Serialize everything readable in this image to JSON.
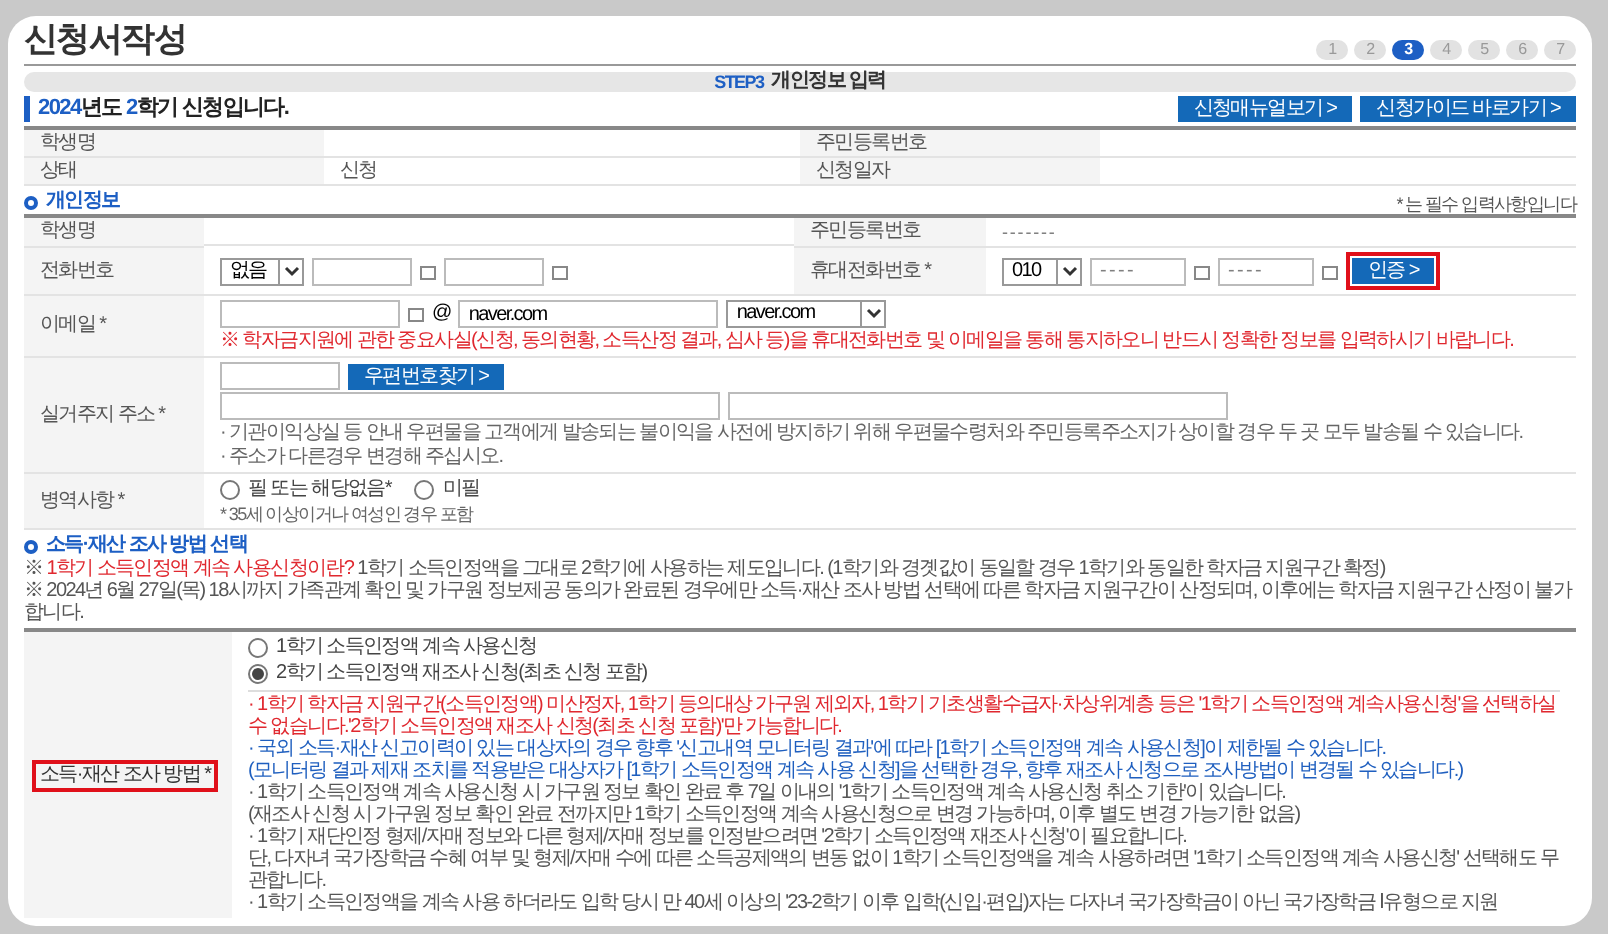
{
  "page_title": "신청서작성",
  "steps": [
    {
      "label": "1",
      "selected": false
    },
    {
      "label": "2",
      "selected": false
    },
    {
      "label": "3",
      "selected": true
    },
    {
      "label": "4",
      "selected": false
    },
    {
      "label": "5",
      "selected": false
    },
    {
      "label": "6",
      "selected": false
    },
    {
      "label": "7",
      "selected": false
    }
  ],
  "step_banner": {
    "step": "STEP3",
    "title": "개인정보 입력"
  },
  "semester_heading": [
    {
      "text": "2024",
      "highlight": true
    },
    {
      "text": "년도 ",
      "highlight": false
    },
    {
      "text": "2",
      "highlight": true
    },
    {
      "text": "학기 신청입니다.",
      "highlight": false
    }
  ],
  "header_buttons": [
    "신청매뉴얼보기 >",
    "신청가이드 바로가기 >"
  ],
  "summary_table": [
    [
      {
        "label": "학생명"
      },
      {
        "label": "주민등록번호"
      }
    ],
    [
      {
        "label": "상태",
        "value": "신청"
      },
      {
        "label": "신청일자"
      }
    ]
  ],
  "personal_info": {
    "title": "개인정보",
    "required_note": "* 는 필수 입력사항입니다",
    "name_row": {
      "label": "학생명",
      "id_label": "주민등록번호",
      "id_value": "- - - - - -   -"
    },
    "phone_row": {
      "label": "전화번호",
      "select": "없음",
      "mobile_label": "휴대전화번호 *",
      "mobile_select": "010",
      "mobile_placeholder": "- - - -",
      "verify_button": {
        "label": "인증 >",
        "highlighted": true
      }
    },
    "email_row": {
      "label": "이메일 *",
      "at": "@",
      "domain": "naver.com",
      "domain_select": "naver.com",
      "warning": "※ 학자금지원에 관한 중요사실(신청, 동의현황, 소득산정 결과, 심사 등)을 휴대전화번호 및 이메일을 통해 통지하오니 반드시 정확한 정보를 입력하시기 바랍니다."
    },
    "address_row": {
      "label": "실거주지 주소 *",
      "zip_button": "우편번호찾기 >",
      "notes": [
        "· 기관이익상실 등 안내 우편물을 고객에게 발송되는 불이익을 사전에 방지하기 위해 우편물수령처와 주민등록주소지가 상이할 경우 두 곳 모두 발송될 수 있습니다.",
        "· 주소가 다른경우 변경해 주십시오."
      ]
    },
    "military_row": {
      "label": "병역사항 *",
      "options": [
        {
          "label": "필 또는 해당없음*",
          "selected": false
        },
        {
          "label": "미필",
          "selected": false
        }
      ],
      "note": "* 35세 이상이거나 여성인 경우 포함"
    }
  },
  "income_section": {
    "title": "소득·재산 조사 방법 선택",
    "notes": [
      [
        {
          "text": "※ ",
          "kind": "plain"
        },
        {
          "text": "1학기 소득인정액 계속 사용신청이란?",
          "kind": "warning"
        },
        {
          "text": " 1학기 소득인정액을 그대로 2학기에 사용하는 제도입니다. (1학기와 경곗값이 동일할 경우 1학기와 동일한 학자금 지원구간 확정)",
          "kind": "plain"
        }
      ],
      [
        {
          "text": "※ 2024년 6월 27일(목) 18시까지 가족관계 확인 및 가구원 정보제공 동의가 완료된 경우에만 소득·재산 조사 방법 선택에 따른 학자금 지원구간이 산정되며, 이후에는 학자금 지원구간 산정이 불가합니다.",
          "kind": "plain"
        }
      ]
    ],
    "row_label": {
      "text": "소득·재산 조사 방법 *",
      "highlighted": true
    },
    "options": [
      {
        "label": "1학기 소득인정액 계속 사용신청",
        "selected": false
      },
      {
        "label": "2학기 소득인정액 재조사 신청(최초 신청 포함)",
        "selected": true
      }
    ],
    "bullets": [
      {
        "kind": "warning",
        "lines": [
          "· 1학기 학자금 지원구간(소득인정액) 미산정자, 1학기 등의대상 가구원 제외자, 1학기 기초생활수급자·차상위계층 등은 '1학기 소득인정액 계속사용신청'을 선택하실 수 없습니다.'2학기 소득인정액 재조사 신청(최초 신청 포함)'만 가능합니다."
        ]
      },
      {
        "kind": "info",
        "lines": [
          "· 국외 소득·재산 신고이력이 있는 대상자의 경우 향후 '신고내역 모니터링 결과'에 따라 [1학기 소득인정액 계속 사용신청]이 제한될 수 있습니다.",
          "(모니터링 결과 제재 조치를 적용받은 대상자가 [1학기 소득인정액 계속 사용 신청]을 선택한 경우, 향후 재조사 신청으로 조사방법이 변경될 수 있습니다.)"
        ]
      },
      {
        "kind": "plain",
        "lines": [
          "· 1학기 소득인정액 계속 사용신청 시 가구원 정보 확인 완료 후 7일 이내의 '1학기 소득인정액 계속 사용신청 취소 기한'이 있습니다.",
          "(재조사 신청 시 가구원 정보 확인 완료 전까지만 1학기 소득인정액 계속 사용신청으로 변경 가능하며, 이후 별도 변경 가능기한 없음)"
        ]
      },
      {
        "kind": "plain",
        "lines": [
          "· 1학기 재단인정 형제/자매 정보와 다른 형제/자매 정보를 인정받으려면 '2학기 소득인정액 재조사 신청'이 필요합니다.",
          "단, 다자녀 국가장학금 수혜 여부 및 형제/자매 수에 따른 소득공제액의 변동 없이 1학기 소득인정액을 계속 사용하려면 '1학기 소득인정액 계속 사용신청' 선택해도 무관합니다."
        ]
      },
      {
        "kind": "plain",
        "lines": [
          "· 1학기 소득인정액을 계속 사용 하더라도 입학 당시 만 40세 이상의 '23-2학기 이후 입학(신입·편입)자는 다자녀 국가장학금이 아닌 국가장학금 Ⅰ유형으로 지원"
        ]
      }
    ]
  }
}
